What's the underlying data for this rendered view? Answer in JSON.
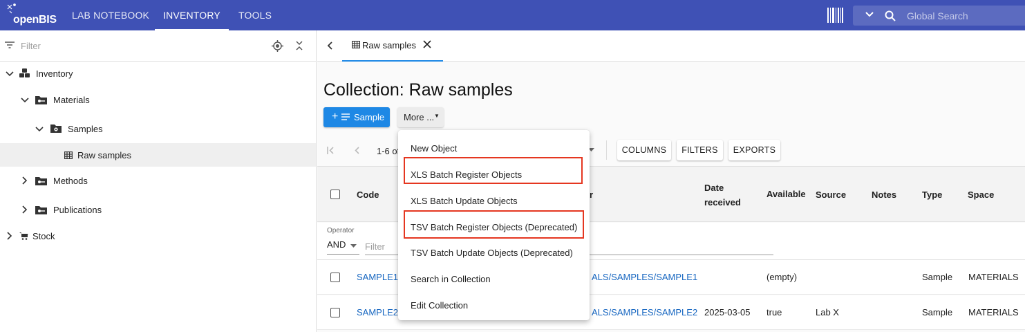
{
  "app": {
    "logo_text": "openBIS",
    "nav": [
      "LAB NOTEBOOK",
      "INVENTORY",
      "TOOLS"
    ],
    "active_nav": "INVENTORY",
    "search_placeholder": "Global Search"
  },
  "sidebar": {
    "filter_placeholder": "Filter",
    "tree": [
      {
        "label": "Inventory",
        "icon": "inventory-icon",
        "expanded": true
      },
      {
        "label": "Materials",
        "icon": "folder-key-icon",
        "expanded": true
      },
      {
        "label": "Samples",
        "icon": "folder-gear-icon",
        "expanded": true
      },
      {
        "label": "Raw samples",
        "icon": "table-icon",
        "selected": true
      },
      {
        "label": "Methods",
        "icon": "folder-key-icon",
        "expanded": false
      },
      {
        "label": "Publications",
        "icon": "folder-key-icon",
        "expanded": false
      },
      {
        "label": "Stock",
        "icon": "cart-icon",
        "expanded": false
      }
    ]
  },
  "tab": {
    "label": "Raw samples"
  },
  "page": {
    "title": "Collection: Raw samples",
    "add_button": "Sample",
    "more_button": "More ..."
  },
  "grid": {
    "page_info": "1-6 of",
    "tools": [
      "COLUMNS",
      "FILTERS",
      "EXPORTS"
    ],
    "headers": {
      "code": "Code",
      "date_received": "Date received",
      "available": "Available",
      "source": "Source",
      "notes": "Notes",
      "type": "Type",
      "space": "Space"
    },
    "operator_label": "Operator",
    "operator_value": "AND",
    "filter_placeholder": "Filter",
    "rows": [
      {
        "code": "SAMPLE1",
        "path": "ALS/SAMPLES/SAMPLE1",
        "date": "",
        "available": "(empty)",
        "source": "",
        "type": "Sample",
        "space": "MATERIALS"
      },
      {
        "code": "SAMPLE2",
        "path": "ALS/SAMPLES/SAMPLE2",
        "date": "2025-03-05",
        "available": "true",
        "source": "Lab X",
        "type": "Sample",
        "space": "MATERIALS"
      }
    ]
  },
  "more_menu": {
    "items": [
      "New Object",
      "XLS Batch Register Objects",
      "XLS Batch Update Objects",
      "TSV Batch Register Objects (Deprecated)",
      "TSV Batch Update Objects (Deprecated)",
      "Search in Collection",
      "Edit Collection"
    ],
    "highlighted": [
      "XLS Batch Register Objects",
      "TSV Batch Register Objects (Deprecated)"
    ],
    "highlight_color": "#e53620"
  },
  "colors": {
    "topbar": "#3f51b5",
    "primary": "#1e88e5",
    "link": "#1565c0"
  }
}
